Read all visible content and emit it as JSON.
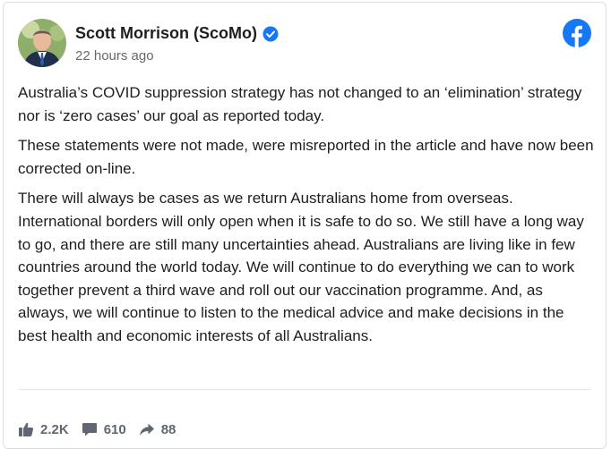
{
  "post": {
    "author": "Scott Morrison (ScoMo)",
    "timestamp": "22 hours ago",
    "paragraphs": [
      "Australia’s COVID suppression strategy has not changed to an ‘elimination’ strategy nor is ‘zero cases’ our goal as reported today.",
      "These statements were not made, were misreported in the article and have now been corrected on-line.",
      "There will always be cases as we return Australians home from overseas. International borders will only open when it is safe to do so. We still have a long way to go, and there are still many uncertainties ahead. Australians are living like in few countries around the world today. We will continue to do everything we can to work together prevent a third wave and roll out our vaccination programme. And, as always, we will continue to listen to the medical advice and make decisions in the best health and economic interests of all Australians."
    ]
  },
  "stats": {
    "likes": "2.2K",
    "comments": "610",
    "shares": "88"
  },
  "icons": {
    "brand": "facebook-icon",
    "verified": "verified-badge-icon",
    "like": "thumbs-up-icon",
    "comment": "comment-icon",
    "share": "share-icon"
  },
  "colors": {
    "facebook_blue": "#1877f2",
    "stat_gray": "#606770"
  }
}
